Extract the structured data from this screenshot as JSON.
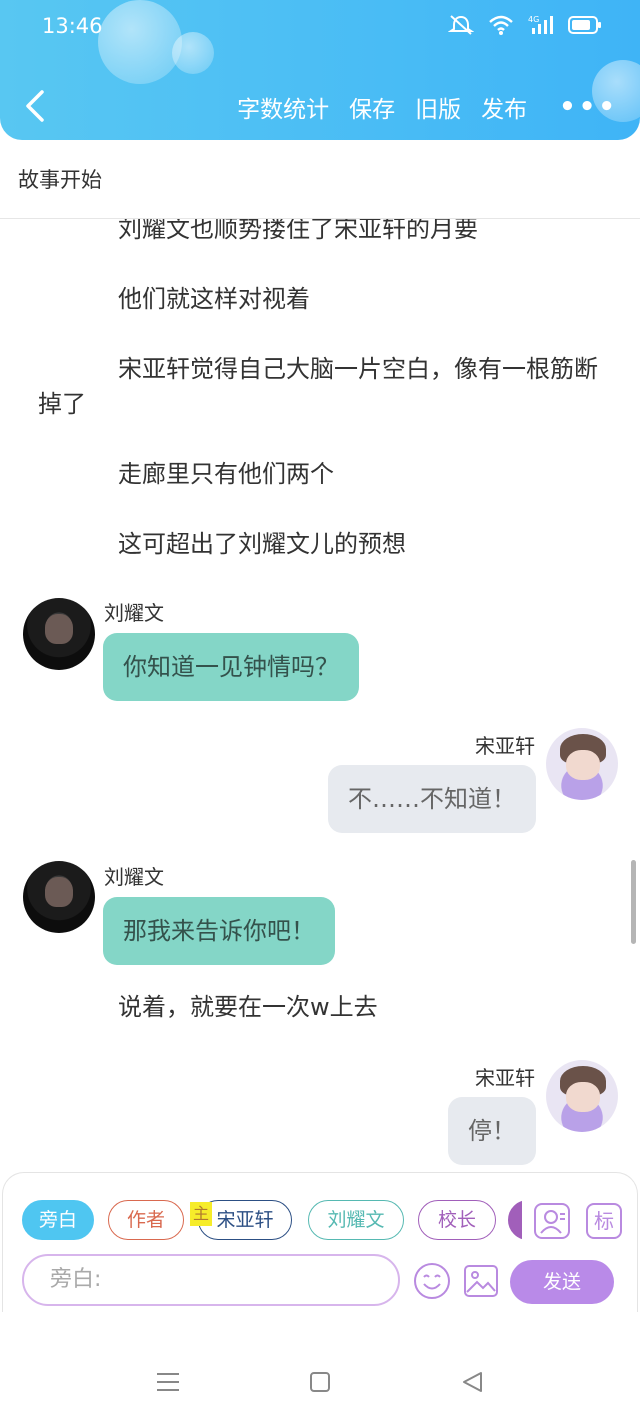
{
  "status_bar": {
    "time": "13:46",
    "network": "4G"
  },
  "toolbar": {
    "word_count_label": "字数统计",
    "save_label": "保存",
    "old_version_label": "旧版",
    "publish_label": "发布",
    "more_label": "•••"
  },
  "chapter": {
    "title": "故事开始"
  },
  "story": {
    "paragraphs": [
      "刘耀文也顺势搂住了宋亚轩的月要",
      "他们就这样对视着",
      "宋亚轩觉得自己大脑一片空白，像有一根筋断掉了",
      "走廊里只有他们两个",
      "这可超出了刘耀文儿的预想",
      "说着，就要在一次w上去"
    ],
    "messages": [
      {
        "speaker": "刘耀文",
        "text": "你知道一见钟情吗？",
        "side": "left"
      },
      {
        "speaker": "宋亚轩",
        "text": "不……不知道！",
        "side": "right"
      },
      {
        "speaker": "刘耀文",
        "text": "那我来告诉你吧！",
        "side": "left"
      },
      {
        "speaker": "宋亚轩",
        "text": "停！",
        "side": "right"
      }
    ]
  },
  "roles": {
    "narration": "旁白",
    "author": "作者",
    "main_badge": "主",
    "song": "宋亚轩",
    "liu": "刘耀文",
    "principal": "校长"
  },
  "input": {
    "placeholder": "旁白:",
    "mark_label": "标",
    "send_label": "发送"
  },
  "colors": {
    "header": "#49bcf5",
    "left_bubble": "#84d6c7",
    "right_bubble": "#e7eaef",
    "send_button": "#b98ae8"
  }
}
